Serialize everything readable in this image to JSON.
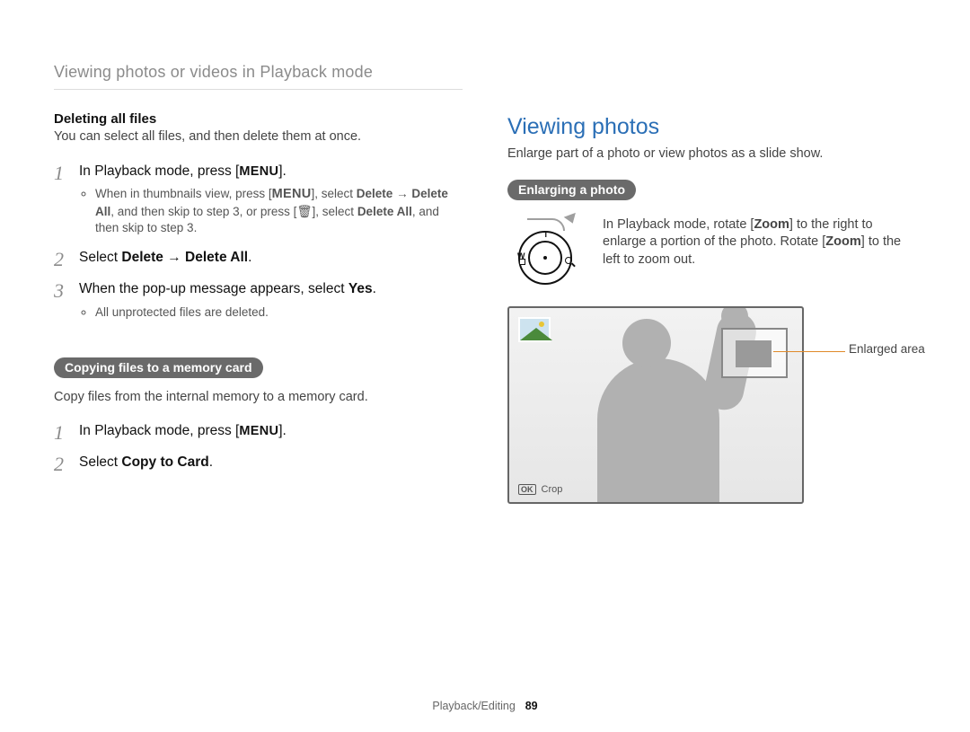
{
  "header": {
    "title": "Viewing photos or videos in Playback mode"
  },
  "labels": {
    "menu": "MENU"
  },
  "left": {
    "deleting": {
      "heading": "Deleting all files",
      "intro": "You can select all files, and then delete them at once.",
      "step1_pre": "In Playback mode, press [",
      "step1_post": "].",
      "bullet_a_pre": "When in thumbnails view, press [",
      "bullet_a_mid": "], select ",
      "bullet_a_delete": "Delete",
      "bullet_a_arrow": " → ",
      "bullet_a_deleteall": "Delete All",
      "bullet_a_then": ", and then skip to step 3, or press [",
      "bullet_a_trash": "🗑",
      "bullet_a_select": "], select ",
      "bullet_a_deleteall2": "Delete All",
      "bullet_a_tail": ", and then skip to step 3.",
      "step2_pre": "Select ",
      "step2_delete": "Delete",
      "step2_arrow": " → ",
      "step2_deleteall": "Delete All",
      "step2_post": ".",
      "step3_pre": "When the pop-up message appears, select ",
      "step3_yes": "Yes",
      "step3_post": ".",
      "bullet_b": "All unprotected files are deleted."
    },
    "copying": {
      "pill": "Copying files to a memory card",
      "intro": "Copy files from the internal memory to a memory card.",
      "step1_pre": "In Playback mode, press [",
      "step1_post": "].",
      "step2_pre": "Select ",
      "step2_bold": "Copy to Card",
      "step2_post": "."
    }
  },
  "right": {
    "title": "Viewing photos",
    "intro": "Enlarge part of a photo or view photos as a slide show.",
    "pill": "Enlarging a photo",
    "desc_pre": "In Playback mode, rotate [",
    "desc_zoom": "Zoom",
    "desc_mid": "] to the right to enlarge a portion of the photo. Rotate [",
    "desc_zoom2": "Zoom",
    "desc_post": "] to the left to zoom out.",
    "dial": {
      "w": "W",
      "t": "T"
    },
    "preview": {
      "ok": "OK",
      "crop": "Crop",
      "leader": "Enlarged area"
    }
  },
  "footer": {
    "section": "Playback/Editing",
    "page": "89"
  }
}
